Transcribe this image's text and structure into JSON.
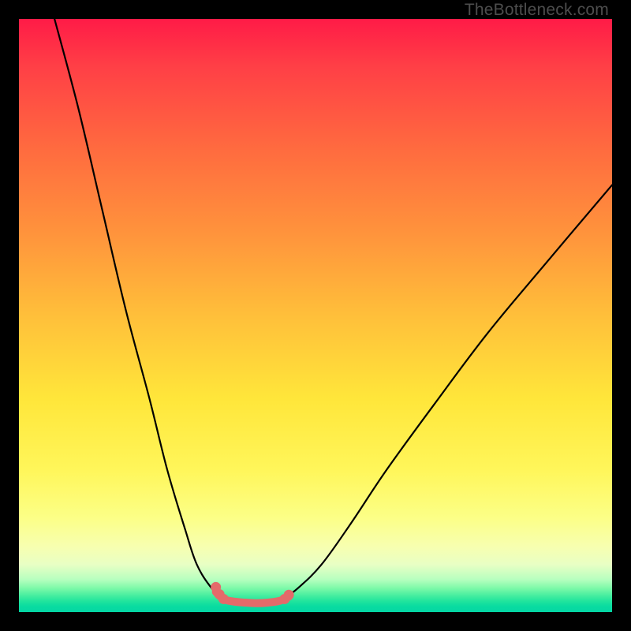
{
  "watermark": {
    "text": "TheBottleneck.com"
  },
  "chart_data": {
    "type": "line",
    "title": "",
    "xlabel": "",
    "ylabel": "",
    "xlim": [
      0,
      100
    ],
    "ylim": [
      0,
      100
    ],
    "grid": false,
    "legend": false,
    "description": "Bottleneck-style V curve: two black arcs descending from upper corners to a flat minimum near the bottom center; short salmon highlight segment with dots across the minimum; rainbow vertical gradient background (red top → green bottom).",
    "series": [
      {
        "name": "left-black-curve",
        "x": [
          6,
          10,
          14,
          18,
          22,
          25,
          28,
          30,
          32.5,
          34.5
        ],
        "y": [
          100,
          85,
          68,
          51,
          36,
          24,
          14,
          8,
          4,
          2.2
        ]
      },
      {
        "name": "right-black-curve",
        "x": [
          44.5,
          47,
          51,
          56,
          62,
          70,
          79,
          89,
          100
        ],
        "y": [
          2.2,
          4,
          8,
          15,
          24,
          35,
          47,
          59,
          72
        ]
      },
      {
        "name": "flat-minimum",
        "x": [
          34.5,
          37,
          40,
          42,
          44.5
        ],
        "y": [
          2.2,
          1.6,
          1.5,
          1.6,
          2.2
        ]
      },
      {
        "name": "salmon-highlight",
        "x": [
          33.2,
          34.5,
          36,
          38,
          40,
          42,
          44,
          45.5
        ],
        "y": [
          3.4,
          2.2,
          1.8,
          1.6,
          1.5,
          1.6,
          1.9,
          2.6
        ]
      }
    ],
    "markers": {
      "name": "salmon-dots",
      "points": [
        {
          "x": 33.2,
          "y": 4.2
        },
        {
          "x": 33.8,
          "y": 3.0
        },
        {
          "x": 34.5,
          "y": 2.2
        },
        {
          "x": 44.8,
          "y": 2.2
        },
        {
          "x": 45.5,
          "y": 2.9
        }
      ]
    },
    "background_gradient": [
      {
        "stop": 0,
        "color": "#ff1b47"
      },
      {
        "stop": 0.5,
        "color": "#ffe63a"
      },
      {
        "stop": 0.9,
        "color": "#f7ffb0"
      },
      {
        "stop": 1.0,
        "color": "#04d6a4"
      }
    ]
  }
}
